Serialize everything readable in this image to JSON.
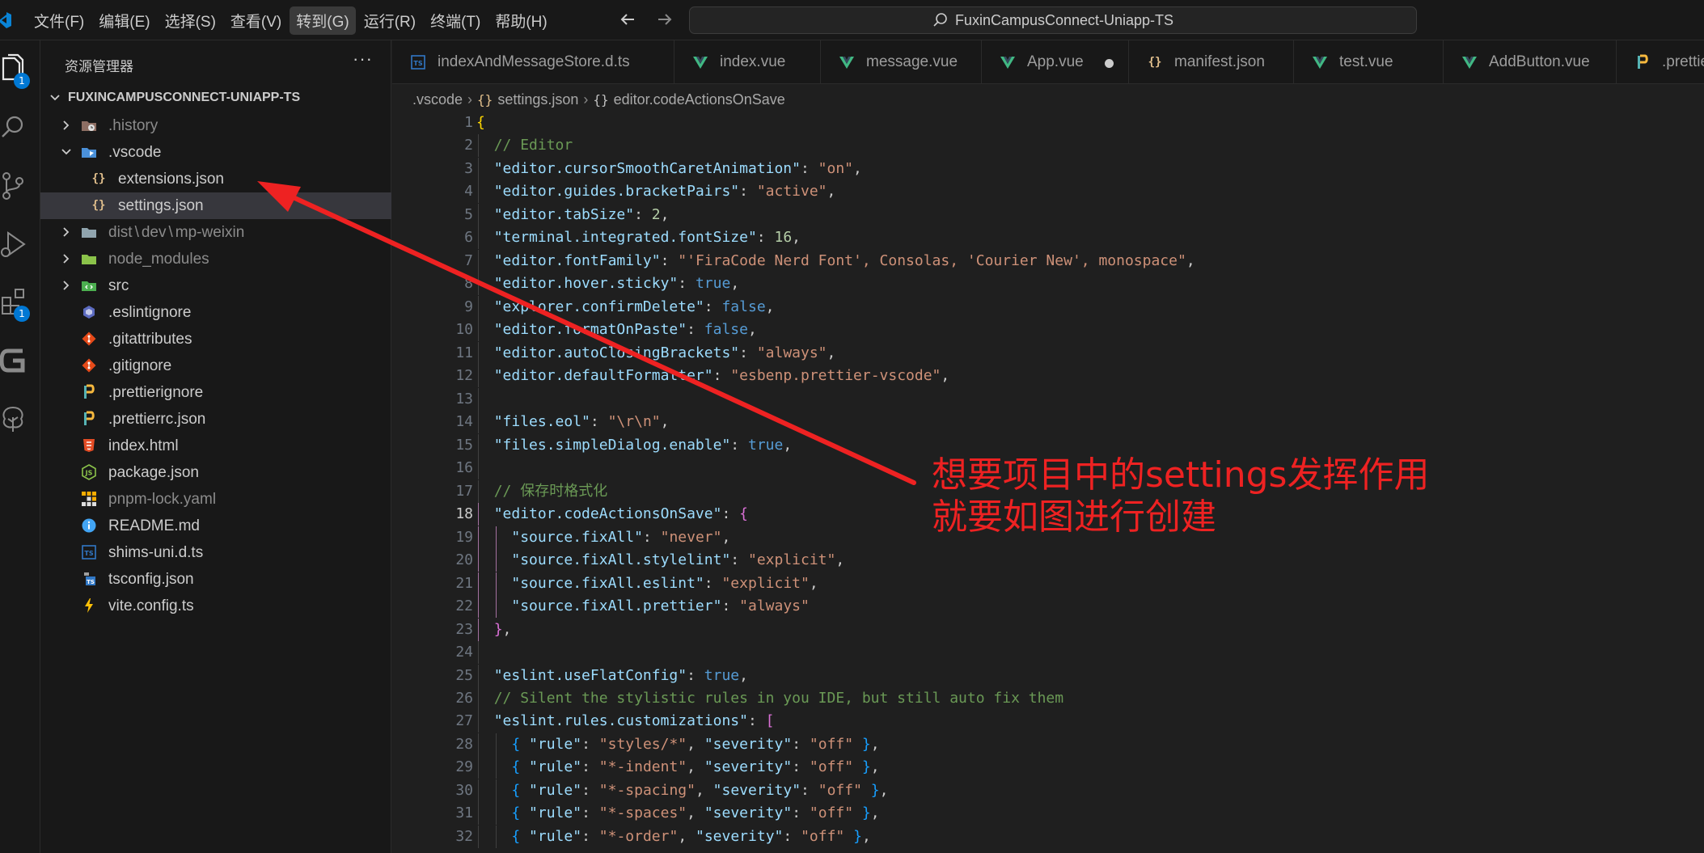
{
  "menubar": {
    "items": [
      "文件(F)",
      "编辑(E)",
      "选择(S)",
      "查看(V)",
      "转到(G)",
      "运行(R)",
      "终端(T)",
      "帮助(H)"
    ]
  },
  "command_center": {
    "text": "FuxinCampusConnect-Uniapp-TS"
  },
  "activitybar": {
    "explorer_badge": "1",
    "extensions_badge": "1"
  },
  "sidebar": {
    "header": "资源管理器",
    "more": "···",
    "root": "FUXINCAMPUSCONNECT-UNIAPP-TS",
    "items": [
      {
        "label": ".history",
        "type": "folder",
        "icon": "history-folder-icon"
      },
      {
        "label": ".vscode",
        "type": "folder-open",
        "icon": "vscode-folder-icon"
      },
      {
        "label": "extensions.json",
        "type": "file",
        "icon": "json-icon"
      },
      {
        "label": "settings.json",
        "type": "file",
        "icon": "json-icon"
      },
      {
        "label": "dist",
        "label_b": "dev",
        "label_c": "mp-weixin",
        "sep": "\\",
        "type": "folder",
        "icon": "folder-icon"
      },
      {
        "label": "node_modules",
        "type": "folder",
        "icon": "node-folder-icon"
      },
      {
        "label": "src",
        "type": "folder",
        "icon": "src-folder-icon"
      },
      {
        "label": ".eslintignore",
        "type": "file",
        "icon": "eslint-icon"
      },
      {
        "label": ".gitattributes",
        "type": "file",
        "icon": "git-icon"
      },
      {
        "label": ".gitignore",
        "type": "file",
        "icon": "git-icon"
      },
      {
        "label": ".prettierignore",
        "type": "file",
        "icon": "prettier-icon"
      },
      {
        "label": ".prettierrc.json",
        "type": "file",
        "icon": "prettier-icon"
      },
      {
        "label": "index.html",
        "type": "file",
        "icon": "html-icon"
      },
      {
        "label": "package.json",
        "type": "file",
        "icon": "nodejs-icon"
      },
      {
        "label": "pnpm-lock.yaml",
        "type": "file",
        "icon": "pnpm-icon"
      },
      {
        "label": "README.md",
        "type": "file",
        "icon": "info-icon"
      },
      {
        "label": "shims-uni.d.ts",
        "type": "file",
        "icon": "typescript-def-icon"
      },
      {
        "label": "tsconfig.json",
        "type": "file",
        "icon": "tsconfig-icon"
      },
      {
        "label": "vite.config.ts",
        "type": "file",
        "icon": "vite-icon"
      }
    ]
  },
  "tabs": [
    {
      "label": "indexAndMessageStore.d.ts",
      "icon": "typescript-def-icon"
    },
    {
      "label": "index.vue",
      "icon": "vue-icon"
    },
    {
      "label": "message.vue",
      "icon": "vue-icon"
    },
    {
      "label": "App.vue",
      "icon": "vue-icon",
      "modified": true
    },
    {
      "label": "manifest.json",
      "icon": "json-icon"
    },
    {
      "label": "test.vue",
      "icon": "vue-icon"
    },
    {
      "label": "AddButton.vue",
      "icon": "vue-icon"
    },
    {
      "label": ".prettie",
      "icon": "prettier-icon"
    }
  ],
  "breadcrumb": {
    "folder": ".vscode",
    "file": "settings.json",
    "symbol": "editor.codeActionsOnSave",
    "file_brace": "{}",
    "symbol_brace": "{}"
  },
  "editor": {
    "current_line": 18,
    "lines": [
      "{",
      "  // Editor",
      "  \"editor.cursorSmoothCaretAnimation\": \"on\",",
      "  \"editor.guides.bracketPairs\": \"active\",",
      "  \"editor.tabSize\": 2,",
      "  \"terminal.integrated.fontSize\": 16,",
      "  \"editor.fontFamily\": \"'FiraCode Nerd Font', Consolas, 'Courier New', monospace\",",
      "  \"editor.hover.sticky\": true,",
      "  \"explorer.confirmDelete\": false,",
      "  \"editor.formatOnPaste\": false,",
      "  \"editor.autoClosingBrackets\": \"always\",",
      "  \"editor.defaultFormatter\": \"esbenp.prettier-vscode\",",
      "",
      "  \"files.eol\": \"\\r\\n\",",
      "  \"files.simpleDialog.enable\": true,",
      "",
      "  // 保存时格式化",
      "  \"editor.codeActionsOnSave\": {",
      "    \"source.fixAll\": \"never\",",
      "    \"source.fixAll.stylelint\": \"explicit\",",
      "    \"source.fixAll.eslint\": \"explicit\",",
      "    \"source.fixAll.prettier\": \"always\"",
      "  },",
      "",
      "  \"eslint.useFlatConfig\": true,",
      "  // Silent the stylistic rules in you IDE, but still auto fix them",
      "  \"eslint.rules.customizations\": [",
      "    { \"rule\": \"styles/*\", \"severity\": \"off\" },",
      "    { \"rule\": \"*-indent\", \"severity\": \"off\" },",
      "    { \"rule\": \"*-spacing\", \"severity\": \"off\" },",
      "    { \"rule\": \"*-spaces\", \"severity\": \"off\" },",
      "    { \"rule\": \"*-order\", \"severity\": \"off\" },"
    ]
  },
  "annotation": {
    "line1": "想要项目中的settings发挥作用",
    "line2": "就要如图进行创建",
    "color": "#ee2222"
  },
  "colors": {
    "accent": "#0078d4",
    "annotation": "#ee2222"
  }
}
